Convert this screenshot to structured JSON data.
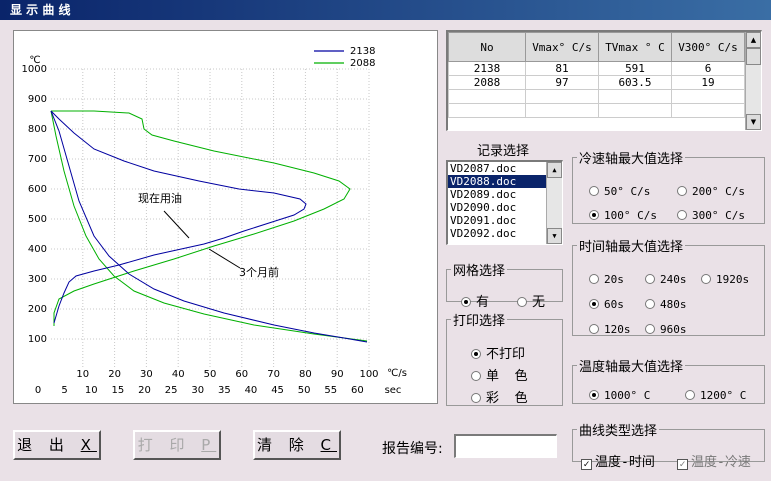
{
  "window": {
    "title": "显 示 曲 线"
  },
  "chart_data": {
    "type": "line",
    "y_unit": "℃",
    "yticks": [
      "1000",
      "900",
      "800",
      "700",
      "600",
      "500",
      "400",
      "300",
      "200",
      "100"
    ],
    "x_top_ticks": [
      "10",
      "20",
      "30",
      "40",
      "50",
      "60",
      "70",
      "80",
      "90",
      "100"
    ],
    "x_top_unit": "℃/s",
    "x_bottom_ticks": [
      "0",
      "5",
      "10",
      "15",
      "20",
      "25",
      "30",
      "35",
      "40",
      "45",
      "50",
      "55",
      "60"
    ],
    "x_bottom_unit": "sec",
    "ylim": [
      0,
      1000
    ],
    "legend": "top-right",
    "series": [
      {
        "name": "2138",
        "color": "#0000a0"
      },
      {
        "name": "2088",
        "color": "#00b000"
      }
    ],
    "annotations": [
      "现在用油",
      "3个月前"
    ]
  },
  "table": {
    "headers": [
      "No",
      "Vmax° C/s",
      "TVmax ° C",
      "V300° C/s"
    ],
    "rows": [
      [
        "2138",
        "81",
        "591",
        "6"
      ],
      [
        "2088",
        "97",
        "603.5",
        "19"
      ]
    ]
  },
  "records": {
    "label": "记录选择",
    "items": [
      "VD2087.doc",
      "VD2088.doc",
      "VD2089.doc",
      "VD2090.doc",
      "VD2091.doc",
      "VD2092.doc"
    ],
    "selected": "VD2088.doc"
  },
  "grid_select": {
    "label": "网格选择",
    "options": [
      "有",
      "无"
    ],
    "selected": "有"
  },
  "print_select": {
    "label": "打印选择",
    "options": [
      "不打印",
      "单  色",
      "彩  色"
    ],
    "selected": "不打印"
  },
  "cool_axis": {
    "label": "冷速轴最大值选择",
    "options": [
      "50° C/s",
      "200° C/s",
      "100° C/s",
      "300° C/s"
    ],
    "selected": "100° C/s"
  },
  "time_axis": {
    "label": "时间轴最大值选择",
    "options": [
      "20s",
      "240s",
      "1920s",
      "60s",
      "480s",
      "120s",
      "960s"
    ],
    "selected": "60s"
  },
  "temp_axis": {
    "label": "温度轴最大值选择",
    "options": [
      "1000° C",
      "1200° C"
    ],
    "selected": "1000° C"
  },
  "curve_type": {
    "label": "曲线类型选择",
    "options": [
      "温度-时间",
      "温度-冷速"
    ],
    "checked": [
      true,
      true
    ]
  },
  "buttons": {
    "exit": "退 出",
    "exit_key": "X",
    "print": "打 印",
    "print_key": "P",
    "clear": "清 除",
    "clear_key": "C"
  },
  "report": {
    "label": "报告编号:",
    "value": ""
  }
}
